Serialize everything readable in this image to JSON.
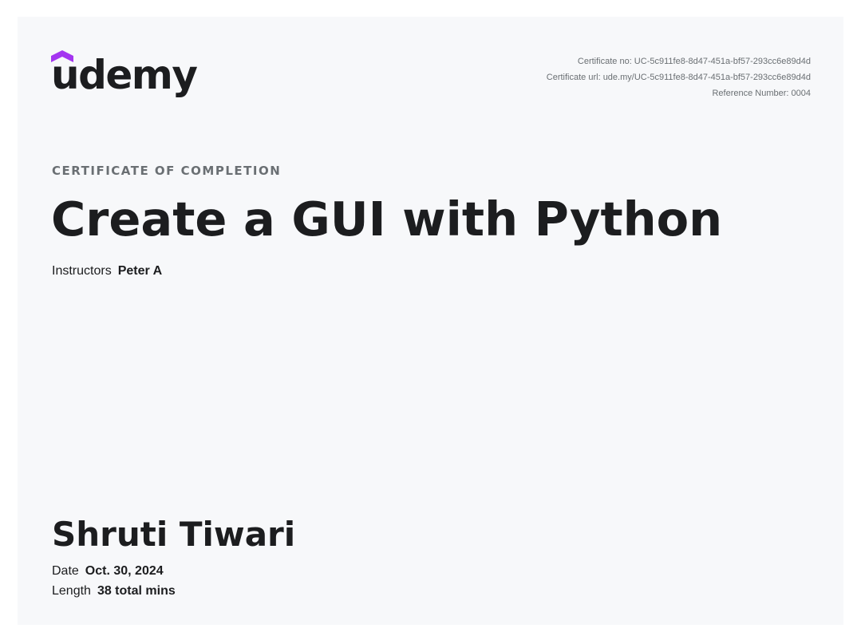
{
  "brand": {
    "name": "udemy",
    "accent_color": "#a435f0",
    "icon": "udemy-hat-icon"
  },
  "meta": {
    "certificate_no": "Certificate no: UC-5c911fe8-8d47-451a-bf57-293cc6e89d4d",
    "certificate_url": "Certificate url: ude.my/UC-5c911fe8-8d47-451a-bf57-293cc6e89d4d",
    "reference_number": "Reference Number: 0004"
  },
  "certificate": {
    "eyebrow": "CERTIFICATE OF COMPLETION",
    "course_title": "Create a GUI with Python",
    "instructors_label": "Instructors",
    "instructors_value": "Peter A",
    "recipient": "Shruti Tiwari",
    "date_label": "Date",
    "date_value": "Oct. 30, 2024",
    "length_label": "Length",
    "length_value": "38 total mins"
  }
}
